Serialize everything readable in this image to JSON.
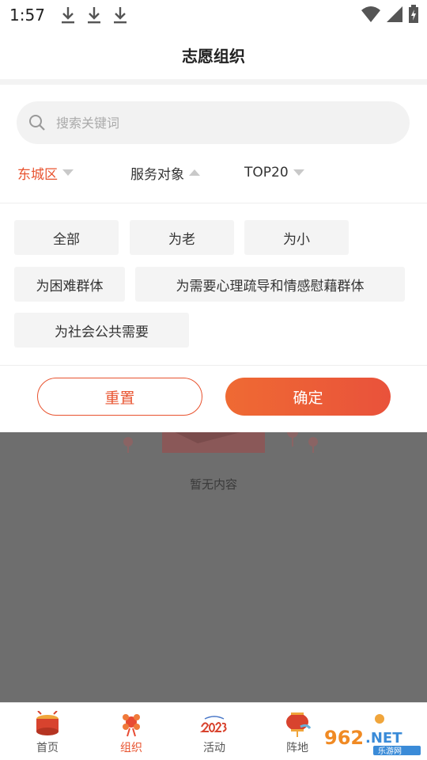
{
  "status_bar": {
    "time": "1:57"
  },
  "header": {
    "title": "志愿组织"
  },
  "search": {
    "placeholder": "搜索关键词"
  },
  "filters": [
    {
      "label": "东城区",
      "active": true,
      "caret": "down"
    },
    {
      "label": "服务对象",
      "active": false,
      "caret": "up"
    },
    {
      "label": "TOP20",
      "active": false,
      "caret": "down"
    }
  ],
  "tags": [
    "全部",
    "为老",
    "为小",
    "为困难群体",
    "为需要心理疏导和情感慰藉群体",
    "为社会公共需要"
  ],
  "actions": {
    "reset": "重置",
    "confirm": "确定"
  },
  "empty_state": {
    "text": "暂无内容"
  },
  "bottom_nav": [
    {
      "label": "首页",
      "icon": "home-drum-icon",
      "active": false
    },
    {
      "label": "组织",
      "icon": "organization-knot-icon",
      "active": true
    },
    {
      "label": "活动",
      "icon": "activity-2023-icon",
      "active": false
    },
    {
      "label": "阵地",
      "icon": "position-lantern-icon",
      "active": false
    }
  ],
  "watermark": {
    "text": "962.NET",
    "subtext": "乐游网"
  },
  "colors": {
    "accent": "#e8532f",
    "overlay": "#6e6e6e",
    "tag_bg": "#f4f4f4"
  }
}
